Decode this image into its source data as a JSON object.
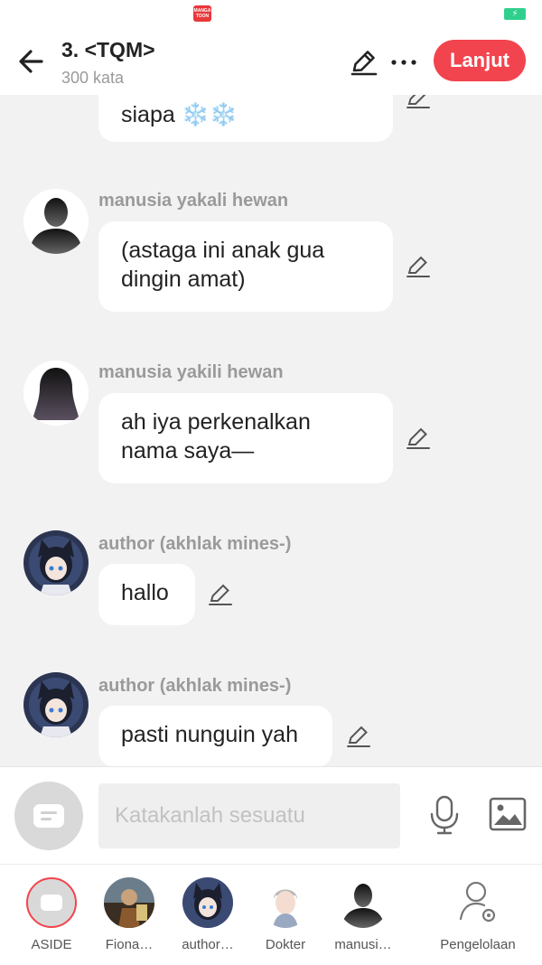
{
  "statusbar": {
    "app_logo_text": "MANGA TOON",
    "battery_icon": "battery-charging-icon",
    "battery_color": "#2fd08e"
  },
  "header": {
    "title": "3. <TQM>",
    "subtitle": "300 kata",
    "continue_label": "Lanjut",
    "accent_color": "#f2444e",
    "icons": [
      "back-arrow-icon",
      "pencil-icon",
      "more-dots-icon"
    ]
  },
  "messages": [
    {
      "sender": "",
      "text": "siapa ❄️❄️",
      "avatar": "none"
    },
    {
      "sender": "manusia yakali hewan",
      "text": "(astaga ini anak gua dingin amat)",
      "avatar": "silhouette-male"
    },
    {
      "sender": "manusia yakili hewan",
      "text": "ah iya perkenalkan nama saya—",
      "avatar": "silhouette-female"
    },
    {
      "sender": "author (akhlak mines-)",
      "text": "hallo",
      "avatar": "anime-cat-girl"
    },
    {
      "sender": "author (akhlak mines-)",
      "text": "pasti nunguin yah",
      "avatar": "anime-cat-girl"
    }
  ],
  "composer": {
    "placeholder": "Katakanlah sesuatu",
    "icons": [
      "chat-bubble-icon",
      "microphone-icon",
      "image-icon"
    ]
  },
  "tabs": [
    {
      "label": "ASIDE",
      "icon": "aside-chat-icon"
    },
    {
      "label": "Fiona…",
      "icon": "avatar-fiona"
    },
    {
      "label": "author…",
      "icon": "avatar-author"
    },
    {
      "label": "Dokter",
      "icon": "avatar-dokter"
    },
    {
      "label": "manusi…",
      "icon": "avatar-manusia"
    },
    {
      "label": "Pengelolaan",
      "icon": "user-settings-icon"
    }
  ]
}
